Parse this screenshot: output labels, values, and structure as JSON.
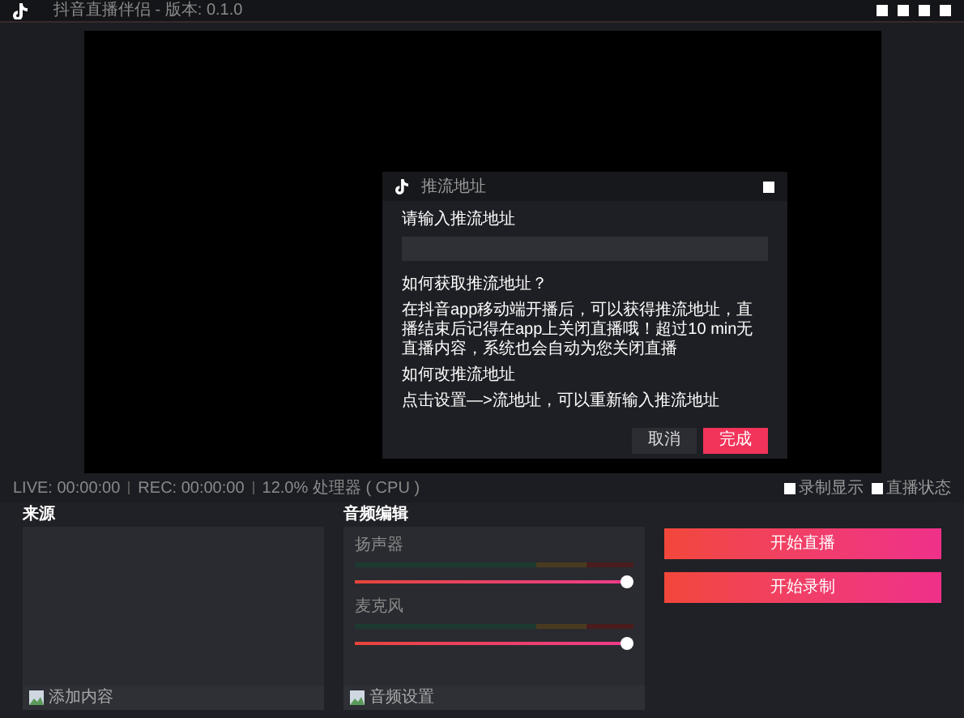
{
  "window": {
    "title": "抖音直播伴侣 - 版本: 0.1.0"
  },
  "dialog": {
    "title": "推流地址",
    "field_label": "请输入推流地址",
    "help_heading": "如何获取推流地址？",
    "help_text": "在抖音app移动端开播后，可以获得推流地址，直播结束后记得在app上关闭直播哦！超过10 min无直播内容，系统也会自动为您关闭直播",
    "change_heading": "如何改推流地址",
    "change_text": "点击设置—>流地址，可以重新输入推流地址",
    "buttons": [
      {
        "label": "取消",
        "kind": "secondary"
      },
      {
        "label": "完成",
        "kind": "primary"
      }
    ]
  },
  "status_bar": {
    "items": [
      "LIVE: 00:00:00",
      "REC: 00:00:00",
      "12.0% 处理器 ( CPU )"
    ],
    "toggles": [
      {
        "label": "录制显示",
        "checked": false
      },
      {
        "label": "直播状态",
        "checked": false
      }
    ]
  },
  "sources": {
    "title": "来源",
    "add_label": "添加内容"
  },
  "audio": {
    "title": "音频编辑",
    "channels": [
      {
        "name": "扬声器",
        "level": 1.0
      },
      {
        "name": "麦克风",
        "level": 1.0
      }
    ],
    "settings_label": "音频设置"
  },
  "actions": [
    {
      "label": "开始直播"
    },
    {
      "label": "开始录制"
    }
  ]
}
